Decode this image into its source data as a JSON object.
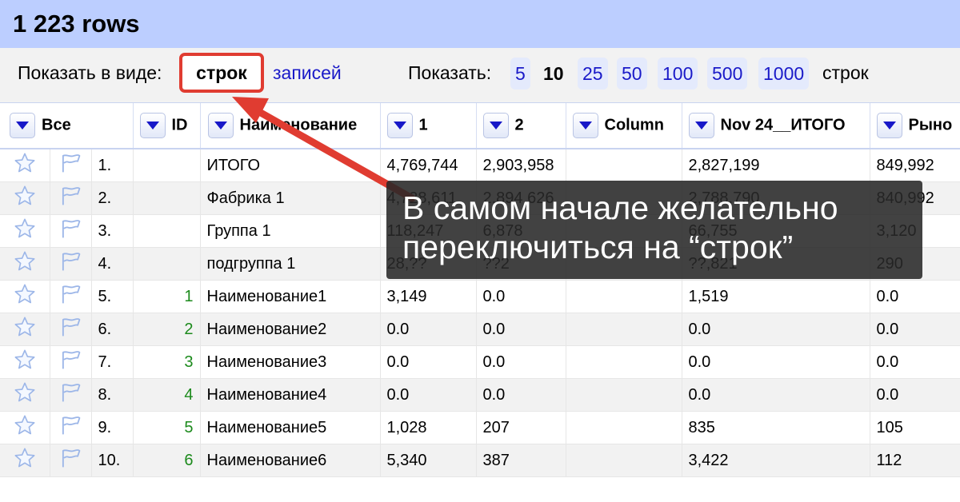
{
  "header": {
    "title": "1 223 rows"
  },
  "view_mode": {
    "label": "Показать в виде:",
    "active": "строк",
    "other": "записей"
  },
  "page_size": {
    "label": "Показать:",
    "options": [
      "5",
      "10",
      "25",
      "50",
      "100",
      "500",
      "1000"
    ],
    "active": "10",
    "suffix": "строк"
  },
  "table": {
    "columns": [
      "Все",
      "ID",
      "Наименование",
      "1",
      "2",
      "Column",
      "Nov 24__ИТОГО",
      "Рыно"
    ],
    "rows": [
      {
        "n": "1.",
        "id": "",
        "name": "ИТОГО",
        "c1": "4,769,744",
        "c2": "2,903,958",
        "col": "",
        "nov": "2,827,199",
        "r": "849,992"
      },
      {
        "n": "2.",
        "id": "",
        "name": "Фабрика 1",
        "c1": "4,728,611",
        "c2": "2,894,626",
        "col": "",
        "nov": "2,788,790",
        "r": "840,992"
      },
      {
        "n": "3.",
        "id": "",
        "name": "Группа 1",
        "c1": "118,247",
        "c2": "6,878",
        "col": "",
        "nov": "66,755",
        "r": "3,120"
      },
      {
        "n": "4.",
        "id": "",
        "name": "подгруппа 1",
        "c1": "28,??",
        "c2": "??2",
        "col": "",
        "nov": "??,821",
        "r": "290"
      },
      {
        "n": "5.",
        "id": "1",
        "name": "Наименование1",
        "c1": "3,149",
        "c2": "0.0",
        "col": "",
        "nov": "1,519",
        "r": "0.0"
      },
      {
        "n": "6.",
        "id": "2",
        "name": "Наименование2",
        "c1": "0.0",
        "c2": "0.0",
        "col": "",
        "nov": "0.0",
        "r": "0.0"
      },
      {
        "n": "7.",
        "id": "3",
        "name": "Наименование3",
        "c1": "0.0",
        "c2": "0.0",
        "col": "",
        "nov": "0.0",
        "r": "0.0"
      },
      {
        "n": "8.",
        "id": "4",
        "name": "Наименование4",
        "c1": "0.0",
        "c2": "0.0",
        "col": "",
        "nov": "0.0",
        "r": "0.0"
      },
      {
        "n": "9.",
        "id": "5",
        "name": "Наименование5",
        "c1": "1,028",
        "c2": "207",
        "col": "",
        "nov": "835",
        "r": "105"
      },
      {
        "n": "10.",
        "id": "6",
        "name": "Наименование6",
        "c1": "5,340",
        "c2": "387",
        "col": "",
        "nov": "3,422",
        "r": "112"
      }
    ]
  },
  "annotation": {
    "line1": "В самом начале желательно",
    "line2": "переключиться на “строк”",
    "arrow_color": "#e03c31"
  },
  "icons": [
    "star-icon",
    "flag-icon",
    "dropdown-arrow-icon"
  ]
}
